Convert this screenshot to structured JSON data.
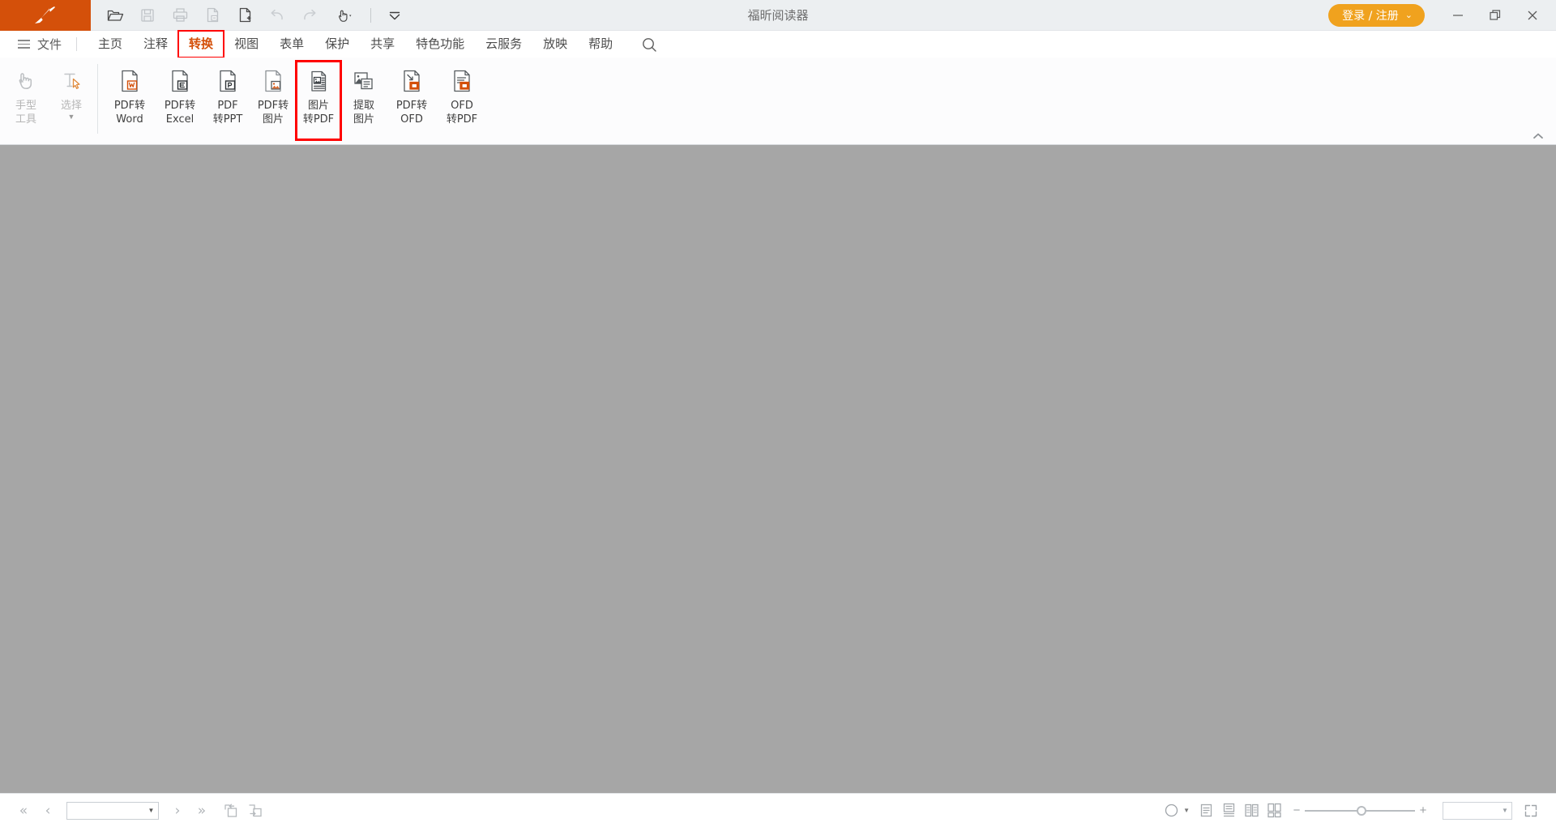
{
  "window": {
    "title": "福昕阅读器",
    "login_label": "登录 / 注册",
    "login_chevron": "⌄",
    "minimize": "—",
    "restore": "❐",
    "close": "✕",
    "accent_color": "#d4500a",
    "login_color": "#f0a21e",
    "highlight_color": "#ff0000"
  },
  "quick_toolbar": {
    "items": [
      {
        "name": "open-file",
        "icon": "folder-open-icon",
        "disabled": false
      },
      {
        "name": "save",
        "icon": "save-icon",
        "disabled": true
      },
      {
        "name": "print",
        "icon": "printer-icon",
        "disabled": true
      },
      {
        "name": "remove-page",
        "icon": "page-remove-icon",
        "disabled": true
      },
      {
        "name": "add-page",
        "icon": "page-add-icon",
        "disabled": false
      },
      {
        "name": "undo",
        "icon": "undo-icon",
        "disabled": true
      },
      {
        "name": "redo",
        "icon": "redo-icon",
        "disabled": true
      },
      {
        "name": "touch-mode",
        "icon": "hand-touch-icon",
        "disabled": false
      }
    ],
    "customize": {
      "name": "customize-toolbar",
      "icon": "chevron-down-bar-icon"
    }
  },
  "menubar": {
    "file_label": "文件",
    "items": [
      {
        "label": "主页",
        "active": false,
        "boxed": false
      },
      {
        "label": "注释",
        "active": false,
        "boxed": false
      },
      {
        "label": "转换",
        "active": true,
        "boxed": true
      },
      {
        "label": "视图",
        "active": false,
        "boxed": false
      },
      {
        "label": "表单",
        "active": false,
        "boxed": false
      },
      {
        "label": "保护",
        "active": false,
        "boxed": false
      },
      {
        "label": "共享",
        "active": false,
        "boxed": false
      },
      {
        "label": "特色功能",
        "active": false,
        "boxed": false
      },
      {
        "label": "云服务",
        "active": false,
        "boxed": false
      },
      {
        "label": "放映",
        "active": false,
        "boxed": false
      },
      {
        "label": "帮助",
        "active": false,
        "boxed": false
      }
    ],
    "search_icon": "search-icon"
  },
  "ribbon": {
    "tools_group": [
      {
        "label": "手型\n工具",
        "icon": "hand-icon",
        "disabled": true,
        "caret": false,
        "boxed": false
      },
      {
        "label": "选择",
        "icon": "text-select-icon",
        "disabled": true,
        "caret": true,
        "boxed": false
      }
    ],
    "convert_group": [
      {
        "label": "PDF转\nWord",
        "icon": "pdf-to-word-icon",
        "disabled": false,
        "caret": false,
        "boxed": false
      },
      {
        "label": "PDF转\nExcel",
        "icon": "pdf-to-excel-icon",
        "disabled": false,
        "caret": false,
        "boxed": false
      },
      {
        "label": "PDF\n转PPT",
        "icon": "pdf-to-ppt-icon",
        "disabled": false,
        "caret": false,
        "boxed": false
      },
      {
        "label": "PDF转\n图片",
        "icon": "pdf-to-image-icon",
        "disabled": false,
        "caret": false,
        "boxed": false
      },
      {
        "label": "图片\n转PDF",
        "icon": "image-to-pdf-icon",
        "disabled": false,
        "caret": false,
        "boxed": true
      },
      {
        "label": "提取\n图片",
        "icon": "extract-image-icon",
        "disabled": false,
        "caret": false,
        "boxed": false
      },
      {
        "label": "PDF转\nOFD",
        "icon": "pdf-to-ofd-icon",
        "disabled": false,
        "caret": false,
        "boxed": false
      },
      {
        "label": "OFD\n转PDF",
        "icon": "ofd-to-pdf-icon",
        "disabled": false,
        "caret": false,
        "boxed": false
      }
    ],
    "collapse_icon": "chevron-up-icon"
  },
  "document": {
    "background_color": "#a6a6a6",
    "content": ""
  },
  "statusbar": {
    "first_page": "«",
    "prev_page": "‹",
    "page_value": "",
    "page_dropdown_arrow": "▼",
    "next_page": "›",
    "last_page": "»",
    "prev_view_icon": "previous-view-icon",
    "next_view_icon": "next-view-icon",
    "theme_icon": "read-mode-icon",
    "theme_caret": "▼",
    "layout_single": "single-page-layout-icon",
    "layout_continuous": "continuous-layout-icon",
    "layout_facing": "facing-pages-layout-icon",
    "layout_facing_continuous": "continuous-facing-layout-icon",
    "zoom_out": "−",
    "zoom_in": "+",
    "zoom_value": "",
    "zoom_dropdown_arrow": "▼",
    "zoom_slider_percent": 52,
    "fullscreen_icon": "fullscreen-icon"
  }
}
